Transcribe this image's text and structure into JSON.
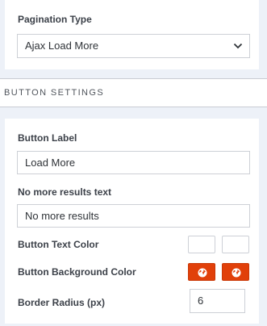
{
  "pagination": {
    "label": "Pagination Type",
    "value": "Ajax Load More"
  },
  "section": {
    "title": "BUTTON SETTINGS"
  },
  "button_label": {
    "label": "Button Label",
    "value": "Load More"
  },
  "no_more_results": {
    "label": "No more results text",
    "value": "No more results"
  },
  "button_text_color": {
    "label": "Button Text Color",
    "swatch_color": "#ffffff"
  },
  "button_background_color": {
    "label": "Button Background Color",
    "swatch_color": "#e1400a",
    "icon": "globe-icon"
  },
  "border_radius": {
    "label": "Border Radius (px)",
    "value": "6"
  },
  "colors": {
    "page_background": "#edf1f8",
    "accent_orange": "#e1400a"
  }
}
